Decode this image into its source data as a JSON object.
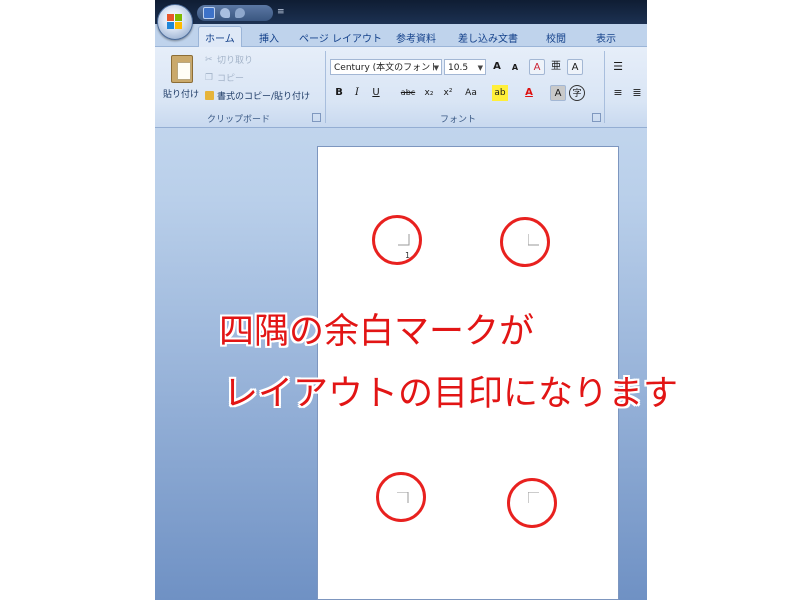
{
  "qat": {
    "more_label": "≡"
  },
  "tabs": [
    {
      "label": "ホーム",
      "active": true
    },
    {
      "label": "挿入"
    },
    {
      "label": "ページ レイアウト"
    },
    {
      "label": "参考資料"
    },
    {
      "label": "差し込み文書"
    },
    {
      "label": "校閲"
    },
    {
      "label": "表示"
    }
  ],
  "clipboard": {
    "paste_label": "貼り付け",
    "cut_label": "切り取り",
    "copy_label": "コピー",
    "format_painter_label": "書式のコピー/貼り付け",
    "group_label": "クリップボード"
  },
  "font_group": {
    "font_name": "Century (本文のフォント",
    "font_size": "10.5",
    "grow_label": "A",
    "shrink_label": "A",
    "clear_label": "A",
    "bold_label": "B",
    "italic_label": "I",
    "underline_label": "U",
    "strike_label": "abc",
    "subscript_label": "x₂",
    "superscript_label": "x²",
    "case_label": "Aa",
    "highlight_label": "ab",
    "font_color_label": "A",
    "shading_label": "A",
    "enclose_label": "字",
    "phonetic_label": "亜",
    "group_label": "フォント"
  },
  "document": {
    "page_number": "1"
  },
  "annotation": {
    "line1": "四隅の余白マークが",
    "line2": "レイアウトの目印になります"
  },
  "colors": {
    "accent_red": "#e8211f",
    "ribbon_text": "#15428b",
    "titlebar": "#1c3152"
  },
  "icons": [
    "office-button-icon",
    "save-icon",
    "undo-icon",
    "redo-icon",
    "paste-icon",
    "cut-icon",
    "copy-icon",
    "format-painter-icon",
    "bullets-icon",
    "align-left-icon",
    "align-center-icon"
  ]
}
